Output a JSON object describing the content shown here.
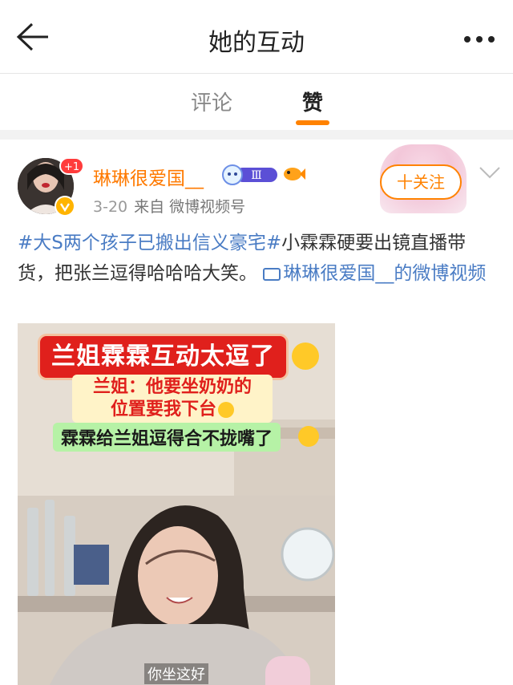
{
  "header": {
    "title": "她的互动"
  },
  "tabs": [
    {
      "label": "评论",
      "active": false
    },
    {
      "label": "赞",
      "active": true
    }
  ],
  "colors": {
    "accent": "#ff8200",
    "link": "#4a7cc4",
    "username": "#ff7a00"
  },
  "post": {
    "user_name": "琳琳很爱国__",
    "avatar_badge": "+1",
    "level_badge": "Ⅲ",
    "date": "3-20",
    "source": "来自 微博视频号",
    "follow_label": "十关注",
    "text": {
      "hashtag": "#大S两个孩子已搬出信义豪宅#",
      "body": "小霖霖硬要出镜直播带货，把张兰逗得哈哈哈大笑。",
      "video_link": "琳琳很爱国__的微博视频"
    },
    "video": {
      "caption_title": "兰姐霖霖互动太逗了",
      "caption_line1": "兰姐：他要坐奶奶的",
      "caption_line2": "位置要我下台",
      "caption_line3": "霖霖给兰姐逗得合不拢嘴了",
      "subtitle": "你坐这好"
    }
  },
  "icons": [
    "back-arrow-icon",
    "more-dots-icon",
    "verified-icon",
    "level-badge-icon",
    "fish-icon",
    "chevron-down-icon",
    "video-link-icon",
    "grin-emoji-icon",
    "laugh-emoji-icon",
    "giggle-emoji-icon"
  ]
}
